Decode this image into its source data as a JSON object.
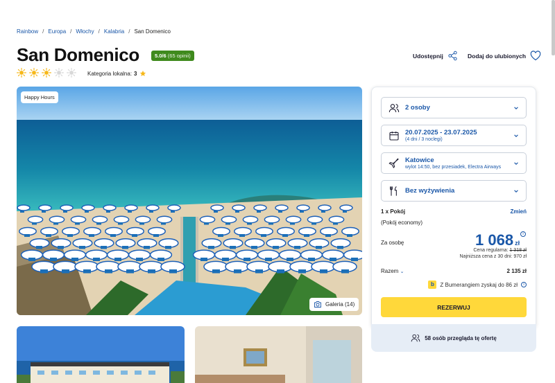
{
  "breadcrumb": {
    "items": [
      "Rainbow",
      "Europa",
      "Włochy",
      "Kalabria"
    ],
    "current": "San Domenico"
  },
  "hotel": {
    "name": "San Domenico",
    "rating": "5.0/6",
    "rating_count": "(65 opinii)",
    "category_label": "Kategoria lokalna:",
    "category_value": "3",
    "suns_filled": 3,
    "suns_total": 5
  },
  "actions": {
    "share_label": "Udostępnij",
    "favorite_label": "Dodaj do ulubionych"
  },
  "gallery": {
    "badge": "Happy Hours",
    "button_label": "Galeria (14)"
  },
  "booking": {
    "guests": "2 osoby",
    "dates": "20.07.2025 - 23.07.2025",
    "dates_sub": "(4 dni / 3 noclegi)",
    "departure": "Katowice",
    "departure_sub": "wylot 14:50, bez przesiadek, Electra Airways",
    "board": "Bez wyżywienia",
    "room_label": "1 x Pokój",
    "room_change": "Zmień",
    "room_type": "(Pokój economy)",
    "per_person_label": "Za osobę",
    "price": "1 068",
    "currency": "zł",
    "regular_price_label": "Cena regularna:",
    "regular_price": "1 318 zł",
    "lowest_price_note": "Najniższa cena z 30 dni: 970 zł",
    "total_label": "Razem",
    "total_value": "2 135 zł",
    "boomerang_text": "Z Bumerangiem zyskaj do 86 zł",
    "reserve_label": "REZERWUJ",
    "viewers_text": "58 osób przegląda tę ofertę"
  },
  "colors": {
    "accent_blue": "#1a57a8",
    "reserve_yellow": "#ffd83a",
    "rating_green": "#3f8a1d",
    "sun_yellow": "#f6b81a"
  }
}
